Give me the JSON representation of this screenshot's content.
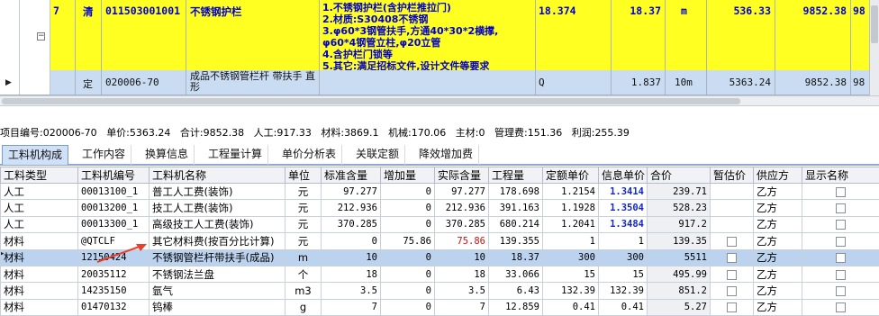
{
  "top_grid": {
    "row_7": {
      "seq": "7",
      "category": "清",
      "code": "011503001001",
      "name": "不锈钢护栏",
      "description_lines": [
        "1.不锈钢护栏(含护栏推拉门)",
        "2.材质:S30408不锈钢",
        "3.φ60*3钢管扶手,方通40*30*2横撑,",
        "φ60*4钢管立柱,φ20立管",
        "4.含护栏门锁等",
        "5.其它:满足招标文件,设计文件等要求"
      ],
      "formula": "18.374",
      "quantity": "18.37",
      "unit": "m",
      "unit_price": "536.33",
      "total": "9852.38",
      "extra": "98"
    },
    "row_ding": {
      "category": "定",
      "code": "020006-70",
      "name": "成品不锈钢管栏杆 带扶手 直形",
      "formula": "Q",
      "quantity": "1.837",
      "unit": "10m",
      "unit_price": "5363.24",
      "total": "9852.38",
      "extra": "98"
    },
    "collapse_symbol": "−"
  },
  "info_bar": {
    "item_code_label": "项目编号:",
    "item_code": "020006-70",
    "unit_price_label": "单价:",
    "unit_price": "5363.24",
    "total_label": "合计:",
    "total": "9852.38",
    "labor_label": "人工:",
    "labor": "917.33",
    "material_label": "材料:",
    "material": "3869.1",
    "machine_label": "机械:",
    "machine": "170.06",
    "main_material_label": "主材:",
    "main_material": "0",
    "management_label": "管理费:",
    "management": "151.36",
    "profit_label": "利润:",
    "profit": "255.39"
  },
  "tabs": [
    "工料机构成",
    "工作内容",
    "换算信息",
    "工程量计算",
    "单价分析表",
    "关联定额",
    "降效增加费"
  ],
  "table": {
    "headers": [
      "工料类型",
      "工料机编号",
      "工料机名称",
      "单位",
      "标准含量",
      "增加量",
      "实际含量",
      "工程量",
      "定额单价",
      "信息单价",
      "合价",
      "暂估价",
      "供应方",
      "显示名称"
    ],
    "rows": [
      {
        "type": "人工",
        "code": "00013100_1",
        "name": "普工人工费(装饰)",
        "unit": "元",
        "std": "97.277",
        "add": "0",
        "actual": "97.277",
        "qty": "178.698",
        "quota_price": "1.2154",
        "info_price": "1.3414",
        "amount": "239.71",
        "supplier": "乙方"
      },
      {
        "type": "人工",
        "code": "00013200_1",
        "name": "技工人工费(装饰)",
        "unit": "元",
        "std": "212.936",
        "add": "0",
        "actual": "212.936",
        "qty": "391.163",
        "quota_price": "1.1928",
        "info_price": "1.3504",
        "amount": "528.23",
        "supplier": "乙方"
      },
      {
        "type": "人工",
        "code": "00013300_1",
        "name": "高级技工人工费(装饰)",
        "unit": "元",
        "std": "370.285",
        "add": "0",
        "actual": "370.285",
        "qty": "680.214",
        "quota_price": "1.2041",
        "info_price": "1.3484",
        "amount": "917.2",
        "supplier": "乙方"
      },
      {
        "type": "材料",
        "code": "@QTCLF",
        "name": "其它材料费(按百分比计算)",
        "unit": "元",
        "std": "0",
        "add": "75.86",
        "actual": "75.86",
        "qty": "139.355",
        "quota_price": "1",
        "info_price": "1",
        "amount": "139.35",
        "supplier": "乙方"
      },
      {
        "type": "材料",
        "code": "12150424",
        "name": "不锈钢管栏杆带扶手(成品)",
        "unit": "m",
        "std": "10",
        "add": "0",
        "actual": "10",
        "qty": "18.37",
        "quota_price": "300",
        "info_price": "300",
        "amount": "5511",
        "supplier": "乙方"
      },
      {
        "type": "材料",
        "code": "20035112",
        "name": "不锈钢法兰盘",
        "unit": "个",
        "std": "18",
        "add": "0",
        "actual": "18",
        "qty": "33.066",
        "quota_price": "15",
        "info_price": "15",
        "amount": "495.99",
        "supplier": "乙方"
      },
      {
        "type": "材料",
        "code": "14235150",
        "name": "氩气",
        "unit": "m3",
        "std": "3.5",
        "add": "0",
        "actual": "3.5",
        "qty": "6.43",
        "quota_price": "132.39",
        "info_price": "132.39",
        "amount": "851.2",
        "supplier": "乙方"
      },
      {
        "type": "材料",
        "code": "01470132",
        "name": "钨棒",
        "unit": "g",
        "std": "7",
        "add": "0",
        "actual": "7",
        "qty": "12.859",
        "quota_price": "0.41",
        "info_price": "0.41",
        "amount": "5.27",
        "supplier": "乙方"
      }
    ]
  },
  "colors": {
    "highlight_row": "#ffff22",
    "selected_row": "#bcd3ef",
    "info_price_text": "#1428c8",
    "changed_value": "#d01010",
    "annotation_arrow": "#e8402a"
  }
}
